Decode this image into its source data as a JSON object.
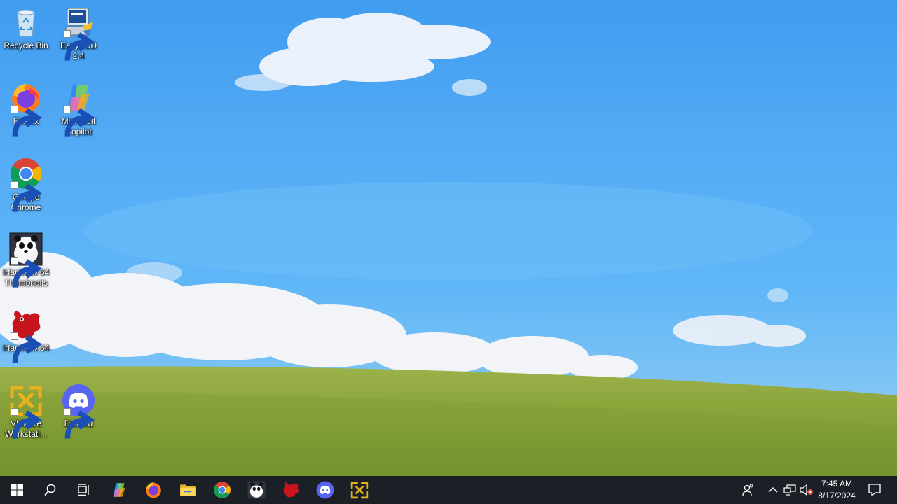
{
  "desktop": {
    "icons": [
      {
        "label": "Recycle Bin",
        "icon": "recycle-bin-icon"
      },
      {
        "label": "EasyBCD 2.4",
        "icon": "easybcd-icon"
      },
      {
        "label": "Firefox",
        "icon": "firefox-icon"
      },
      {
        "label": "Microsoft Copilot",
        "icon": "copilot-icon"
      },
      {
        "label": "Google Chrome",
        "icon": "chrome-icon"
      },
      {
        "label": "IrfanView 64 Thumbnails",
        "icon": "irfanview-thumbnails-icon"
      },
      {
        "label": "IrfanView 64",
        "icon": "irfanview-icon"
      },
      {
        "label": "VMware Workstati...",
        "icon": "vmware-icon"
      },
      {
        "label": "Discord",
        "icon": "discord-icon"
      }
    ]
  },
  "taskbar": {
    "start": "windows-start-icon",
    "search": "search-icon",
    "task_view": "task-view-icon",
    "pinned": [
      "copilot-icon",
      "firefox-icon",
      "file-explorer-icon",
      "chrome-icon",
      "irfanview-thumbnails-icon",
      "irfanview-icon",
      "discord-icon",
      "vmware-icon"
    ],
    "tray": {
      "people": "people-icon",
      "overflow": "chevron-up-icon",
      "network": "network-icon",
      "volume": "volume-muted-icon",
      "time": "7:45 AM",
      "date": "8/17/2024",
      "notifications": "notification-icon"
    }
  },
  "colors": {
    "taskbar": "#1b1f26",
    "sky": "#4aa3f2",
    "grass": "#8aa33a"
  }
}
